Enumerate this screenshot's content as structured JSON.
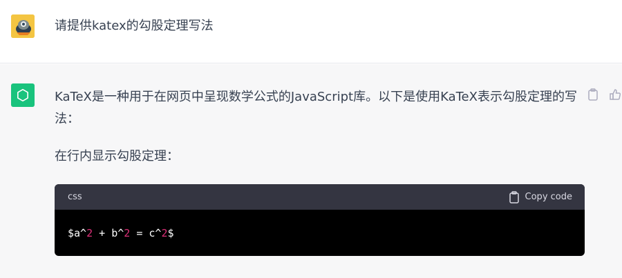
{
  "user_message": {
    "text": "请提供katex的勾股定理写法",
    "avatar_icon": "user-avatar-image"
  },
  "assistant_message": {
    "avatar_icon": "openai-logo-icon",
    "paragraph_1": "KaTeX是一种用于在网页中呈现数学公式的JavaScript库。以下是使用KaTeX表示勾股定理的写法：",
    "paragraph_2": "在行内显示勾股定理：",
    "actions": [
      "clipboard-icon",
      "thumbs-up-icon"
    ]
  },
  "code_block": {
    "language": "css",
    "copy_label": "Copy code",
    "code_tokens": [
      {
        "text": "$a^",
        "type": "plain"
      },
      {
        "text": "2",
        "type": "number"
      },
      {
        "text": " + b^",
        "type": "plain"
      },
      {
        "text": "2",
        "type": "number"
      },
      {
        "text": " = c^",
        "type": "plain"
      },
      {
        "text": "2",
        "type": "number"
      },
      {
        "text": "$",
        "type": "plain"
      }
    ]
  },
  "colors": {
    "assistant_bg": "#f7f7f8",
    "openai_green": "#19c37d",
    "code_header": "#343541",
    "code_number": "#df3079"
  }
}
